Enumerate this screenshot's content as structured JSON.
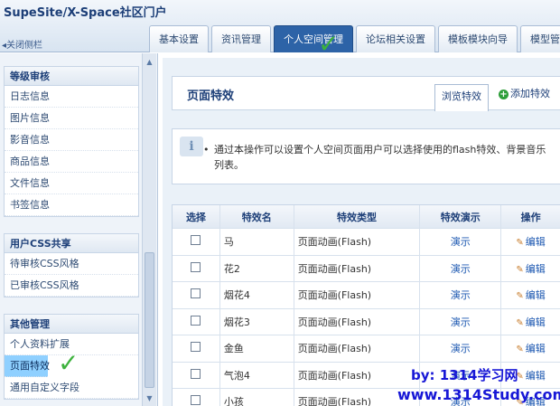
{
  "header": {
    "logo": "SupeSite/X-Space社区门户",
    "collapse_label": "◂关闭侧栏",
    "tabs": [
      {
        "label": "基本设置"
      },
      {
        "label": "资讯管理"
      },
      {
        "label": "个人空间管理"
      },
      {
        "label": "论坛相关设置"
      },
      {
        "label": "模板模块向导"
      },
      {
        "label": "模型管理"
      }
    ]
  },
  "sidebar": {
    "groups": [
      {
        "title": "等级审核",
        "items": [
          "日志信息",
          "图片信息",
          "影音信息",
          "商品信息",
          "文件信息",
          "书签信息"
        ]
      },
      {
        "title": "用户CSS共享",
        "items": [
          "待审核CSS风格",
          "已审核CSS风格"
        ]
      },
      {
        "title": "其他管理",
        "items": [
          "个人资料扩展",
          "页面特效",
          "通用自定义字段"
        ]
      }
    ]
  },
  "main": {
    "panel_title": "页面特效",
    "browse_button": "浏览特效",
    "add_button": "添加特效",
    "tip": "通过本操作可以设置个人空间页面用户可以选择使用的flash特效、背景音乐列表。",
    "table": {
      "headers": [
        "选择",
        "特效名",
        "特效类型",
        "特效演示",
        "操作"
      ],
      "rows": [
        {
          "name": "马",
          "type": "页面动画(Flash)",
          "demo": "演示",
          "action": "编辑"
        },
        {
          "name": "花2",
          "type": "页面动画(Flash)",
          "demo": "演示",
          "action": "编辑"
        },
        {
          "name": "烟花4",
          "type": "页面动画(Flash)",
          "demo": "演示",
          "action": "编辑"
        },
        {
          "name": "烟花3",
          "type": "页面动画(Flash)",
          "demo": "演示",
          "action": "编辑"
        },
        {
          "name": "金鱼",
          "type": "页面动画(Flash)",
          "demo": "演示",
          "action": "编辑"
        },
        {
          "name": "气泡4",
          "type": "页面动画(Flash)",
          "demo": "演示",
          "action": "编辑"
        },
        {
          "name": "小孩",
          "type": "页面动画(Flash)",
          "demo": "演示",
          "action": "编辑"
        }
      ]
    }
  },
  "watermark": {
    "line1": "by: 1314学习网",
    "line2": "www.1314Study.com"
  },
  "colors": {
    "active_tab": "#2d63a7",
    "selected_item": "#8fd0ff",
    "link": "#1a56b0",
    "check_mark": "#3db23d"
  }
}
